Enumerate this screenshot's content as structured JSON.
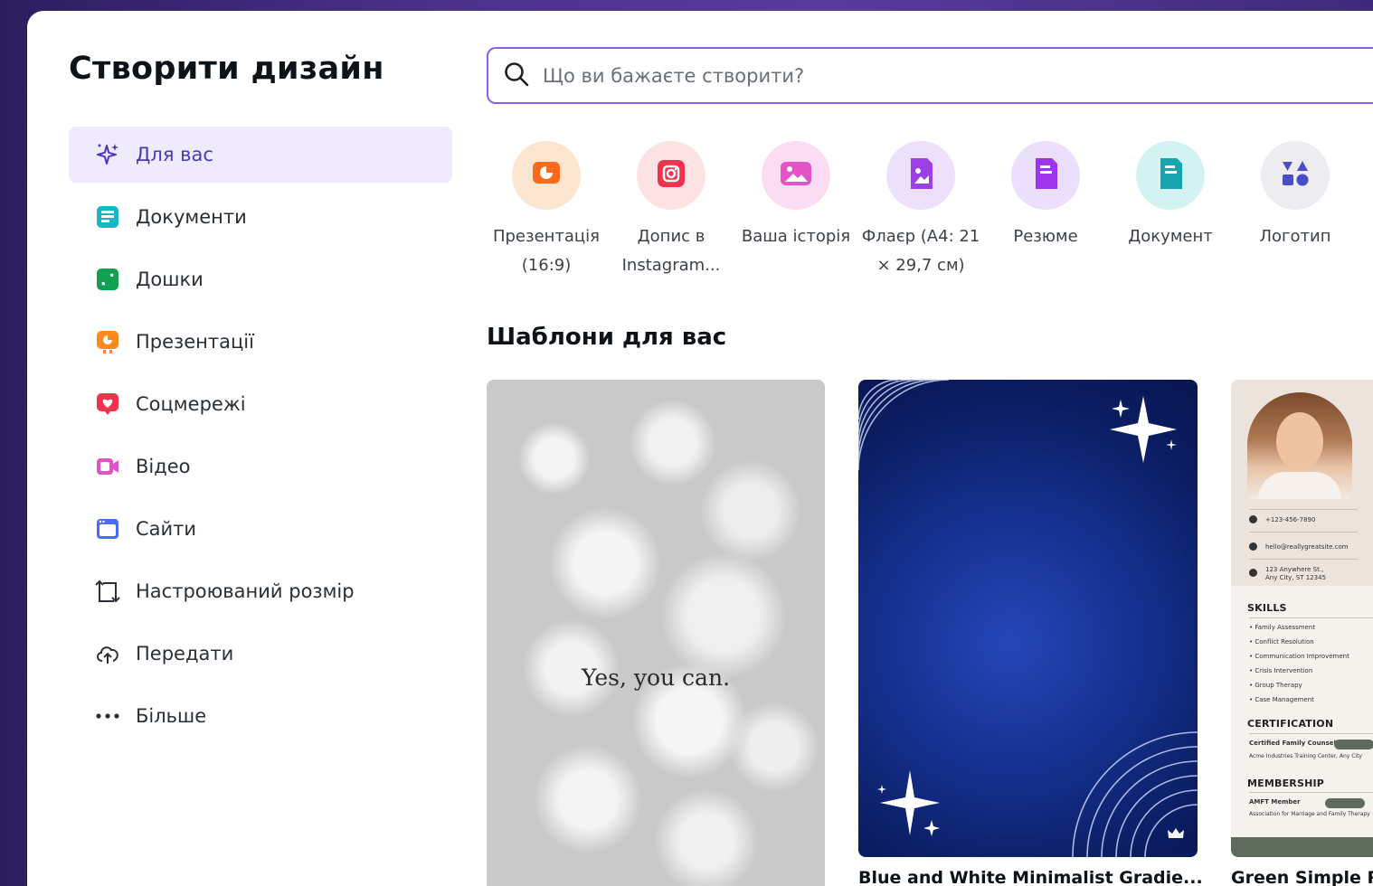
{
  "header": {
    "title": "Створити дизайн"
  },
  "sidebar": {
    "items": [
      {
        "label": "Для вас",
        "icon": "sparkle-icon",
        "active": true
      },
      {
        "label": "Документи",
        "icon": "docs-icon"
      },
      {
        "label": "Дошки",
        "icon": "whiteboard-icon"
      },
      {
        "label": "Презентації",
        "icon": "presentation-icon"
      },
      {
        "label": "Соцмережі",
        "icon": "heart-icon"
      },
      {
        "label": "Відео",
        "icon": "video-icon"
      },
      {
        "label": "Сайти",
        "icon": "website-icon"
      },
      {
        "label": "Настроюваний розмір",
        "icon": "custom-size-icon"
      },
      {
        "label": "Передати",
        "icon": "upload-cloud-icon"
      },
      {
        "label": "Більше",
        "icon": "more-dots-icon"
      }
    ]
  },
  "search": {
    "placeholder": "Що ви бажаєте створити?"
  },
  "categories": [
    {
      "label": "Презентація (16:9)",
      "icon": "presentation-icon",
      "bg": "#fde6cf",
      "color": "#ff6a1a"
    },
    {
      "label": "Допис в Instagram...",
      "icon": "instagram-icon",
      "bg": "#fde2e4",
      "color": "#f0334d"
    },
    {
      "label": "Ваша історія",
      "icon": "image-icon",
      "bg": "#fbdcf2",
      "color": "#e452c8"
    },
    {
      "label": "Флаєр (А4: 21 × 29,7 см)",
      "icon": "flyer-icon",
      "bg": "#ece0fd",
      "color": "#9b3fe6"
    },
    {
      "label": "Резюме",
      "icon": "resume-icon",
      "bg": "#ecdffd",
      "color": "#a034ea"
    },
    {
      "label": "Документ",
      "icon": "document-icon",
      "bg": "#d3f3f3",
      "color": "#14a5b0"
    },
    {
      "label": "Логотип",
      "icon": "logo-shapes-icon",
      "bg": "#ececf1",
      "color": "#4a4dc9"
    }
  ],
  "templates": {
    "title": "Шаблони для вас",
    "cards": [
      {
        "text": "Yes, you can.",
        "caption": ""
      },
      {
        "caption": "Blue and White Minimalist Gradie..."
      },
      {
        "caption": "Green Simple R"
      }
    ],
    "resume": {
      "phone": "+123-456-7890",
      "email": "hello@reallygreatsite.com",
      "address1": "123 Anywhere St.,",
      "address2": "Any City, ST 12345",
      "skills_head": "SKILLS",
      "skills": [
        "Family Assessment",
        "Conflict Resolution",
        "Communication Improvement",
        "Crisis Intervention",
        "Group Therapy",
        "Case Management"
      ],
      "cert_head": "CERTIFICATION",
      "cert_line": "Certified Family Counselor",
      "cert_sub": "Acme Industries Training Center, Any City",
      "member_head": "MEMBERSHIP",
      "member_line": "AMFT Member",
      "member_sub": "Association for Marriage and Family Therapy"
    }
  }
}
